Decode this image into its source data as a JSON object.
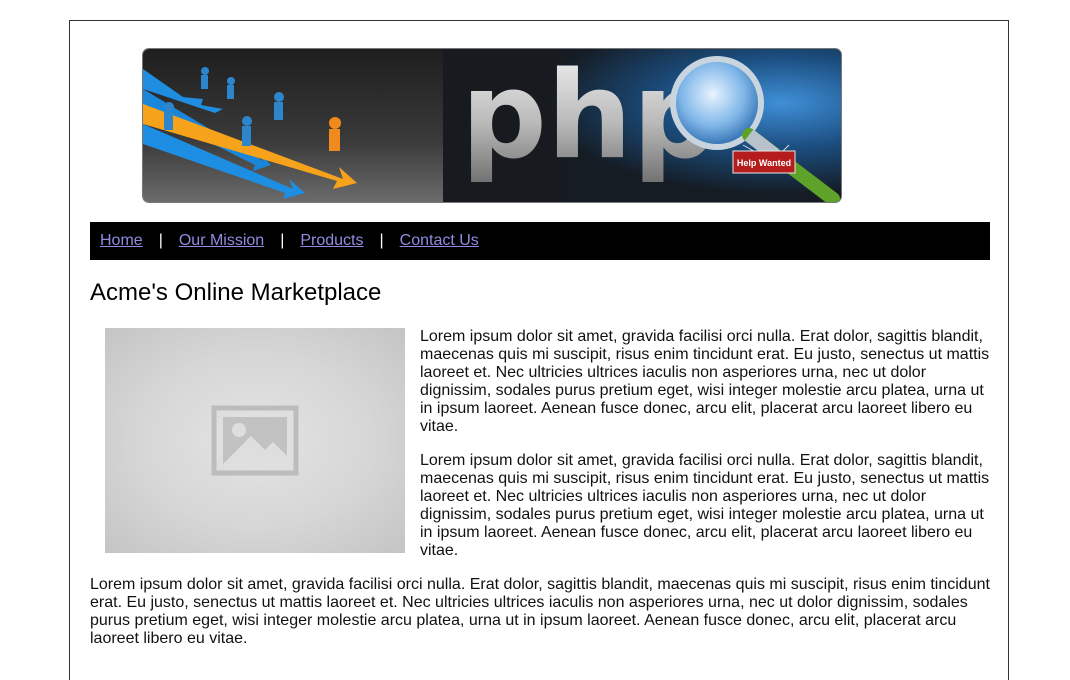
{
  "banner": {
    "logo_text": "php",
    "sign_text": "Help Wanted"
  },
  "nav": {
    "items": [
      {
        "label": "Home"
      },
      {
        "label": "Our Mission"
      },
      {
        "label": "Products"
      },
      {
        "label": "Contact Us"
      }
    ],
    "separator": "|"
  },
  "main": {
    "title": "Acme's Online Marketplace",
    "image": {
      "icon": "image-placeholder-icon"
    },
    "paragraphs": [
      "Lorem ipsum dolor sit amet, gravida facilisi orci nulla. Erat dolor, sagittis blandit, maecenas quis mi suscipit, risus enim tincidunt erat. Eu justo, senectus ut mattis laoreet et. Nec ultricies ultrices iaculis non asperiores urna, nec ut dolor dignissim, sodales purus pretium eget, wisi integer molestie arcu platea, urna ut in ipsum laoreet. Aenean fusce donec, arcu elit, placerat arcu laoreet libero eu vitae.",
      "Lorem ipsum dolor sit amet, gravida facilisi orci nulla. Erat dolor, sagittis blandit, maecenas quis mi suscipit, risus enim tincidunt erat. Eu justo, senectus ut mattis laoreet et. Nec ultricies ultrices iaculis non asperiores urna, nec ut dolor dignissim, sodales purus pretium eget, wisi integer molestie arcu platea, urna ut in ipsum laoreet. Aenean fusce donec, arcu elit, placerat arcu laoreet libero eu vitae.",
      "Lorem ipsum dolor sit amet, gravida facilisi orci nulla. Erat dolor, sagittis blandit, maecenas quis mi suscipit, risus enim tincidunt erat. Eu justo, senectus ut mattis laoreet et. Nec ultricies ultrices iaculis non asperiores urna, nec ut dolor dignissim, sodales purus pretium eget, wisi integer molestie arcu platea, urna ut in ipsum laoreet. Aenean fusce donec, arcu elit, placerat arcu laoreet libero eu vitae."
    ]
  },
  "colors": {
    "nav_background": "#000000",
    "link": "#8f8ce0",
    "separator": "#ffffff"
  }
}
